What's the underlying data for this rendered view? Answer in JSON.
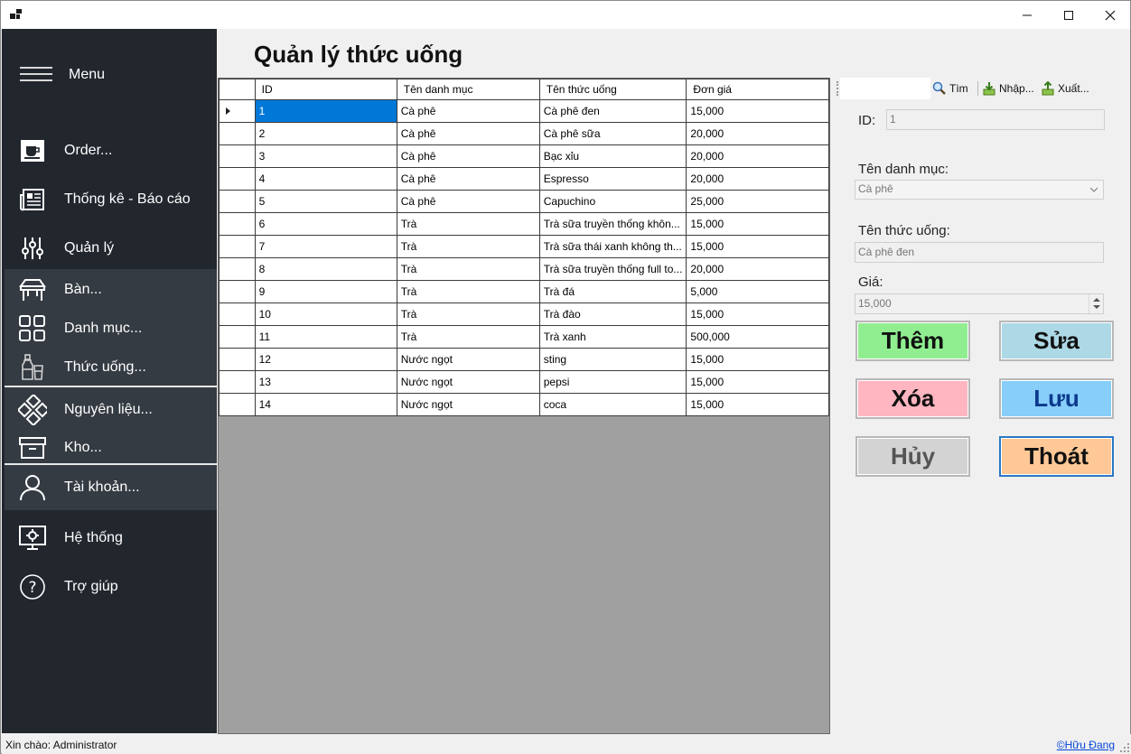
{
  "window": {
    "title": ""
  },
  "sidebar": {
    "menu_label": "Menu",
    "items": [
      {
        "label": "Order...",
        "icon": "coffee-cup-icon"
      },
      {
        "label": "Thống kê - Báo cáo",
        "icon": "newspaper-icon"
      },
      {
        "label": "Quản lý",
        "icon": "sliders-icon"
      },
      {
        "label": "Bàn...",
        "icon": "table-icon"
      },
      {
        "label": "Danh mục...",
        "icon": "grid-icon"
      },
      {
        "label": "Thức uống...",
        "icon": "drinks-icon"
      },
      {
        "label": "Nguyên liệu...",
        "icon": "diamond-grid-icon"
      },
      {
        "label": "Kho...",
        "icon": "archive-box-icon"
      },
      {
        "label": "Tài khoản...",
        "icon": "user-icon"
      },
      {
        "label": "Hệ thống",
        "icon": "monitor-gear-icon"
      },
      {
        "label": "Trợ giúp",
        "icon": "help-circle-icon"
      }
    ]
  },
  "main": {
    "title": "Quản lý thức uống",
    "table": {
      "headers": [
        "ID",
        "Tên danh mục",
        "Tên thức uống",
        "Đơn giá"
      ],
      "selected_row": 0,
      "rows": [
        [
          "1",
          "Cà phê",
          "Cà phê đen",
          "15,000"
        ],
        [
          "2",
          "Cà phê",
          "Cà phê sữa",
          "20,000"
        ],
        [
          "3",
          "Cà phê",
          "Bạc xỉu",
          "20,000"
        ],
        [
          "4",
          "Cà phê",
          "Espresso",
          "20,000"
        ],
        [
          "5",
          "Cà phê",
          "Capuchino",
          "25,000"
        ],
        [
          "6",
          "Trà",
          "Trà sữa truyền thống khôn...",
          "15,000"
        ],
        [
          "7",
          "Trà",
          "Trà sữa thái xanh không th...",
          "15,000"
        ],
        [
          "8",
          "Trà",
          "Trà sữa truyền thống full to...",
          "20,000"
        ],
        [
          "9",
          "Trà",
          "Trà đá",
          "5,000"
        ],
        [
          "10",
          "Trà",
          "Trà đào",
          "15,000"
        ],
        [
          "11",
          "Trà",
          "Trà xanh",
          "500,000"
        ],
        [
          "12",
          "Nước ngọt",
          "sting",
          "15,000"
        ],
        [
          "13",
          "Nước ngọt",
          "pepsi",
          "15,000"
        ],
        [
          "14",
          "Nước ngọt",
          "coca",
          "15,000"
        ]
      ]
    }
  },
  "toolbar": {
    "search_label": "Tìm",
    "import_label": "Nhập...",
    "export_label": "Xuất..."
  },
  "form": {
    "id_label": "ID:",
    "id_value": "1",
    "category_label": "Tên danh mục:",
    "category_value": "Cà phê",
    "name_label": "Tên thức uống:",
    "name_value": "Cà phê đen",
    "price_label": "Giá:",
    "price_value": "15,000"
  },
  "actions": {
    "add": {
      "label": "Thêm",
      "bg": "#90ee90",
      "color": "#111111"
    },
    "edit": {
      "label": "Sửa",
      "bg": "#add8e6",
      "color": "#111111"
    },
    "delete": {
      "label": "Xóa",
      "bg": "#ffb6c1",
      "color": "#111111"
    },
    "save": {
      "label": "Lưu",
      "bg": "#87cefa",
      "color": "#0b3a8c"
    },
    "cancel": {
      "label": "Hủy",
      "bg": "#d3d3d3",
      "color": "#555555"
    },
    "exit": {
      "label": "Thoát",
      "bg": "#ffc896",
      "color": "#111111"
    }
  },
  "statusbar": {
    "greeting": "Xin chào: Administrator",
    "author": "©Hữu Đang"
  },
  "colors": {
    "sidebar_bg": "#22272e",
    "sidebar_sub_bg": "#353b43",
    "selection": "#0078d7",
    "grid_empty": "#a0a0a0"
  }
}
